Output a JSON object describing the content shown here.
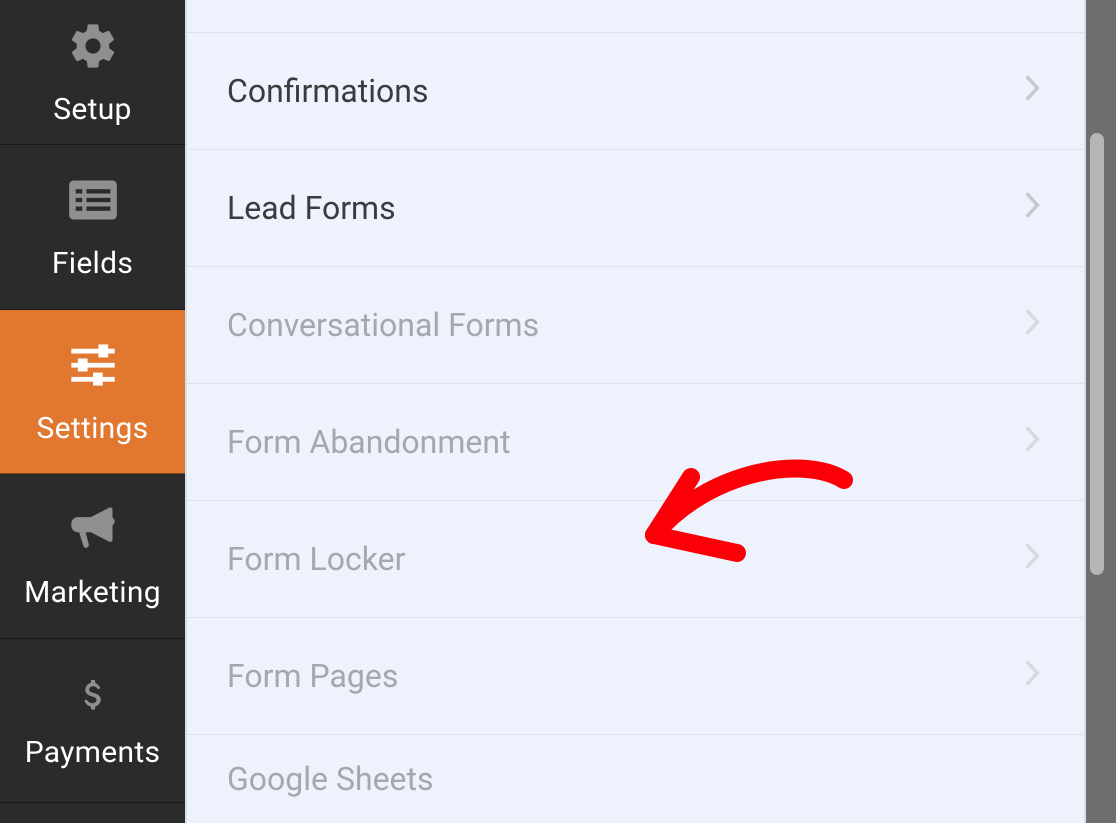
{
  "sidebar": {
    "items": [
      {
        "label": "Setup",
        "icon": "gear-icon",
        "active": false
      },
      {
        "label": "Fields",
        "icon": "list-icon",
        "active": false
      },
      {
        "label": "Settings",
        "icon": "sliders-icon",
        "active": true
      },
      {
        "label": "Marketing",
        "icon": "bullhorn-icon",
        "active": false
      },
      {
        "label": "Payments",
        "icon": "dollar-icon",
        "active": false
      }
    ]
  },
  "settings": {
    "rows": [
      {
        "label": "Confirmations",
        "dimmed": false
      },
      {
        "label": "Lead Forms",
        "dimmed": false
      },
      {
        "label": "Conversational Forms",
        "dimmed": true
      },
      {
        "label": "Form Abandonment",
        "dimmed": true
      },
      {
        "label": "Form Locker",
        "dimmed": true
      },
      {
        "label": "Form Pages",
        "dimmed": true
      },
      {
        "label": "Google Sheets",
        "dimmed": true
      }
    ]
  },
  "colors": {
    "accent": "#e27730"
  }
}
